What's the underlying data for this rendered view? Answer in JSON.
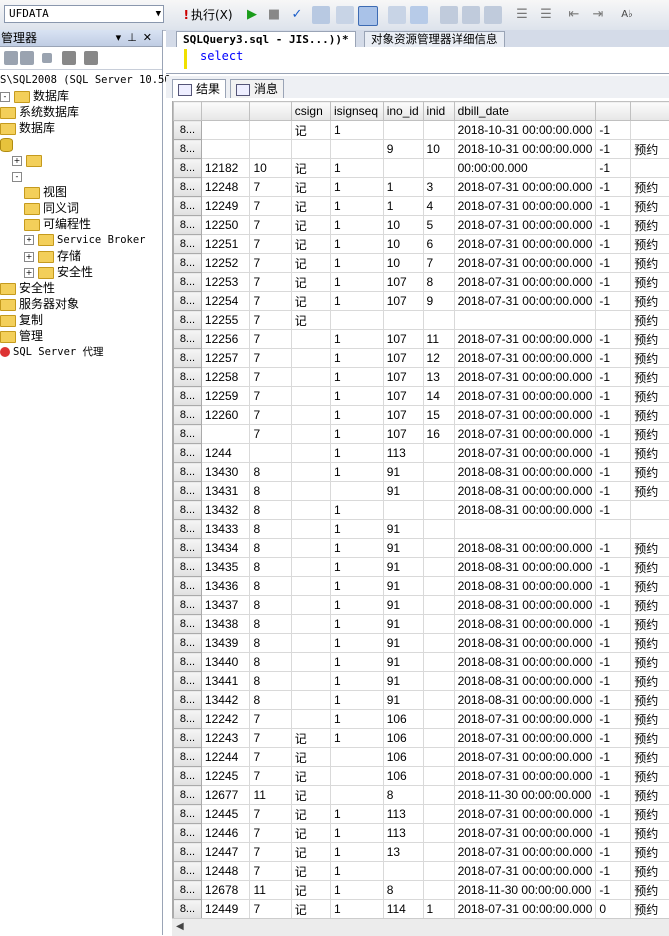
{
  "toolbar": {
    "database": "UFDATA",
    "execute_label": "执行(X)",
    "execute_mark": "!"
  },
  "object_explorer": {
    "title": "管理器",
    "server": "S\\SQL2008 (SQL Server 10.50",
    "items": [
      {
        "label": "数据库",
        "icon": "folder",
        "expander": "-",
        "indent": 0
      },
      {
        "label": "系统数据库",
        "icon": "folder",
        "expander": "",
        "indent": 0
      },
      {
        "label": "数据库",
        "icon": "folder",
        "expander": "",
        "indent": 0
      },
      {
        "label": "",
        "icon": "db",
        "expander": "",
        "indent": 0
      },
      {
        "label": "",
        "icon": "folder",
        "expander": "+",
        "indent": 1
      },
      {
        "label": "",
        "icon": "",
        "expander": "-",
        "indent": 1
      },
      {
        "label": "视图",
        "icon": "folder",
        "expander": "",
        "indent": 2
      },
      {
        "label": "同义词",
        "icon": "folder",
        "expander": "",
        "indent": 2
      },
      {
        "label": "可编程性",
        "icon": "folder",
        "expander": "",
        "indent": 2
      },
      {
        "label": "Service Broker",
        "icon": "folder",
        "expander": "+",
        "indent": 2,
        "mono": true
      },
      {
        "label": "存储",
        "icon": "folder",
        "expander": "+",
        "indent": 2
      },
      {
        "label": "安全性",
        "icon": "folder",
        "expander": "+",
        "indent": 2
      },
      {
        "label": "安全性",
        "icon": "folder",
        "expander": "",
        "indent": 0
      },
      {
        "label": "服务器对象",
        "icon": "folder",
        "expander": "",
        "indent": 0
      },
      {
        "label": "复制",
        "icon": "folder",
        "expander": "",
        "indent": 0
      },
      {
        "label": "管理",
        "icon": "folder",
        "expander": "",
        "indent": 0
      },
      {
        "label": "SQL Server 代理",
        "icon": "agent",
        "expander": "",
        "indent": 0,
        "mono": true
      }
    ]
  },
  "doc_tabs": {
    "active": "SQLQuery3.sql - JIS...))*",
    "other": "对象资源管理器详细信息"
  },
  "editor": {
    "code": "select"
  },
  "result_tabs": {
    "results": "结果",
    "messages": "消息"
  },
  "grid": {
    "columns": [
      "",
      "",
      "csign",
      "isignseq",
      "ino_id",
      "inid",
      "dbill_date",
      "",
      ""
    ],
    "rows": [
      [
        "8...",
        "",
        "",
        "记",
        "1",
        "",
        "",
        "2018-10-31 00:00:00.000",
        "-1",
        ""
      ],
      [
        "8...",
        "",
        "",
        "",
        "",
        "9",
        "10",
        "2018-10-31 00:00:00.000",
        "-1",
        "预约"
      ],
      [
        "8...",
        "12182",
        "10",
        "记",
        "1",
        "",
        "",
        "00:00:00.000",
        "-1",
        ""
      ],
      [
        "8...",
        "12248",
        "7",
        "记",
        "1",
        "1",
        "3",
        "2018-07-31 00:00:00.000",
        "-1",
        "预约"
      ],
      [
        "8...",
        "12249",
        "7",
        "记",
        "1",
        "1",
        "4",
        "2018-07-31 00:00:00.000",
        "-1",
        "预约"
      ],
      [
        "8...",
        "12250",
        "7",
        "记",
        "1",
        "10",
        "5",
        "2018-07-31 00:00:00.000",
        "-1",
        "预约"
      ],
      [
        "8...",
        "12251",
        "7",
        "记",
        "1",
        "10",
        "6",
        "2018-07-31 00:00:00.000",
        "-1",
        "预约"
      ],
      [
        "8...",
        "12252",
        "7",
        "记",
        "1",
        "10",
        "7",
        "2018-07-31 00:00:00.000",
        "-1",
        "预约"
      ],
      [
        "8...",
        "12253",
        "7",
        "记",
        "1",
        "107",
        "8",
        "2018-07-31 00:00:00.000",
        "-1",
        "预约"
      ],
      [
        "8...",
        "12254",
        "7",
        "记",
        "1",
        "107",
        "9",
        "2018-07-31 00:00:00.000",
        "-1",
        "预约"
      ],
      [
        "8...",
        "12255",
        "7",
        "记",
        "",
        "",
        "",
        "",
        "",
        "预约"
      ],
      [
        "8...",
        "12256",
        "7",
        "",
        "1",
        "107",
        "11",
        "2018-07-31 00:00:00.000",
        "-1",
        "预约"
      ],
      [
        "8...",
        "12257",
        "7",
        "",
        "1",
        "107",
        "12",
        "2018-07-31 00:00:00.000",
        "-1",
        "预约"
      ],
      [
        "8...",
        "12258",
        "7",
        "",
        "1",
        "107",
        "13",
        "2018-07-31 00:00:00.000",
        "-1",
        "预约"
      ],
      [
        "8...",
        "12259",
        "7",
        "",
        "1",
        "107",
        "14",
        "2018-07-31 00:00:00.000",
        "-1",
        "预约"
      ],
      [
        "8...",
        "12260",
        "7",
        "",
        "1",
        "107",
        "15",
        "2018-07-31 00:00:00.000",
        "-1",
        "预约"
      ],
      [
        "8...",
        "",
        "7",
        "",
        "1",
        "107",
        "16",
        "2018-07-31 00:00:00.000",
        "-1",
        "预约"
      ],
      [
        "8...",
        "1244",
        "",
        "",
        "1",
        "113",
        "",
        "2018-07-31 00:00:00.000",
        "-1",
        "预约"
      ],
      [
        "8...",
        "13430",
        "8",
        "",
        "1",
        "91",
        "",
        "2018-08-31 00:00:00.000",
        "-1",
        "预约"
      ],
      [
        "8...",
        "13431",
        "8",
        "",
        "",
        "91",
        "",
        "2018-08-31 00:00:00.000",
        "-1",
        "预约"
      ],
      [
        "8...",
        "13432",
        "8",
        "",
        "1",
        "",
        "",
        "2018-08-31 00:00:00.000",
        "-1",
        ""
      ],
      [
        "8...",
        "13433",
        "8",
        "",
        "1",
        "91",
        "",
        "",
        "",
        ""
      ],
      [
        "8...",
        "13434",
        "8",
        "",
        "1",
        "91",
        "",
        "2018-08-31 00:00:00.000",
        "-1",
        "预约"
      ],
      [
        "8...",
        "13435",
        "8",
        "",
        "1",
        "91",
        "",
        "2018-08-31 00:00:00.000",
        "-1",
        "预约"
      ],
      [
        "8...",
        "13436",
        "8",
        "",
        "1",
        "91",
        "",
        "2018-08-31 00:00:00.000",
        "-1",
        "预约"
      ],
      [
        "8...",
        "13437",
        "8",
        "",
        "1",
        "91",
        "",
        "2018-08-31 00:00:00.000",
        "-1",
        "预约"
      ],
      [
        "8...",
        "13438",
        "8",
        "",
        "1",
        "91",
        "",
        "2018-08-31 00:00:00.000",
        "-1",
        "预约"
      ],
      [
        "8...",
        "13439",
        "8",
        "",
        "1",
        "91",
        "",
        "2018-08-31 00:00:00.000",
        "-1",
        "预约"
      ],
      [
        "8...",
        "13440",
        "8",
        "",
        "1",
        "91",
        "",
        "2018-08-31 00:00:00.000",
        "-1",
        "预约"
      ],
      [
        "8...",
        "13441",
        "8",
        "",
        "1",
        "91",
        "",
        "2018-08-31 00:00:00.000",
        "-1",
        "预约"
      ],
      [
        "8...",
        "13442",
        "8",
        "",
        "1",
        "91",
        "",
        "2018-08-31 00:00:00.000",
        "-1",
        "预约"
      ],
      [
        "8...",
        "12242",
        "7",
        "",
        "1",
        "106",
        "",
        "2018-07-31 00:00:00.000",
        "-1",
        "预约"
      ],
      [
        "8...",
        "12243",
        "7",
        "记",
        "1",
        "106",
        "",
        "2018-07-31 00:00:00.000",
        "-1",
        "预约"
      ],
      [
        "8...",
        "12244",
        "7",
        "记",
        "",
        "106",
        "",
        "2018-07-31 00:00:00.000",
        "-1",
        "预约"
      ],
      [
        "8...",
        "12245",
        "7",
        "记",
        "",
        "106",
        "",
        "2018-07-31 00:00:00.000",
        "-1",
        "预约"
      ],
      [
        "8...",
        "12677",
        "11",
        "记",
        "",
        "8",
        "",
        "2018-11-30 00:00:00.000",
        "-1",
        "预约"
      ],
      [
        "8...",
        "12445",
        "7",
        "记",
        "1",
        "113",
        "",
        "2018-07-31 00:00:00.000",
        "-1",
        "预约"
      ],
      [
        "8...",
        "12446",
        "7",
        "记",
        "1",
        "113",
        "",
        "2018-07-31 00:00:00.000",
        "-1",
        "预约"
      ],
      [
        "8...",
        "12447",
        "7",
        "记",
        "1",
        "13",
        "",
        "2018-07-31 00:00:00.000",
        "-1",
        "预约"
      ],
      [
        "8...",
        "12448",
        "7",
        "记",
        "1",
        "",
        "",
        "2018-07-31 00:00:00.000",
        "-1",
        "预约"
      ],
      [
        "8...",
        "12678",
        "11",
        "记",
        "1",
        "8",
        "",
        "2018-11-30 00:00:00.000",
        "-1",
        "预约"
      ],
      [
        "8...",
        "12449",
        "7",
        "记",
        "1",
        "114",
        "1",
        "2018-07-31 00:00:00.000",
        "0",
        "预约"
      ]
    ]
  }
}
